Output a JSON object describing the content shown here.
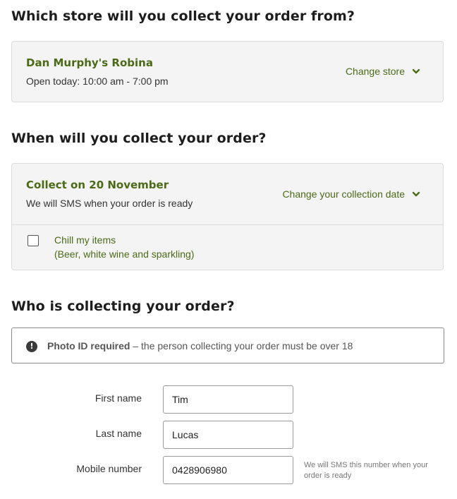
{
  "store_section": {
    "heading": "Which store will you collect your order from?",
    "store_name": "Dan Murphy's Robina",
    "hours": "Open today: 10:00 am - 7:00 pm",
    "change_label": "Change store"
  },
  "date_section": {
    "heading": "When will you collect your order?",
    "collect_label": "Collect on 20 November",
    "sms_note": "We will SMS when your order is ready",
    "change_label": "Change your collection date",
    "chill_label": "Chill my items",
    "chill_sub": "(Beer, white wine and sparkling)",
    "chill_checked": false
  },
  "collector_section": {
    "heading": "Who is collecting your order?",
    "notice_icon": "!",
    "notice_bold": "Photo ID required",
    "notice_text": " – the person collecting your order must be over 18",
    "first_name_label": "First name",
    "first_name_value": "Tim",
    "last_name_label": "Last name",
    "last_name_value": "Lucas",
    "mobile_label": "Mobile number",
    "mobile_value": "0428906980",
    "mobile_helper": "We will SMS this number when your order is ready"
  },
  "colors": {
    "accent_green": "#4a6a16",
    "card_bg": "#f4f4f4"
  },
  "icons": {
    "dropdown": "chevron-down-icon",
    "notice": "exclamation-icon"
  }
}
